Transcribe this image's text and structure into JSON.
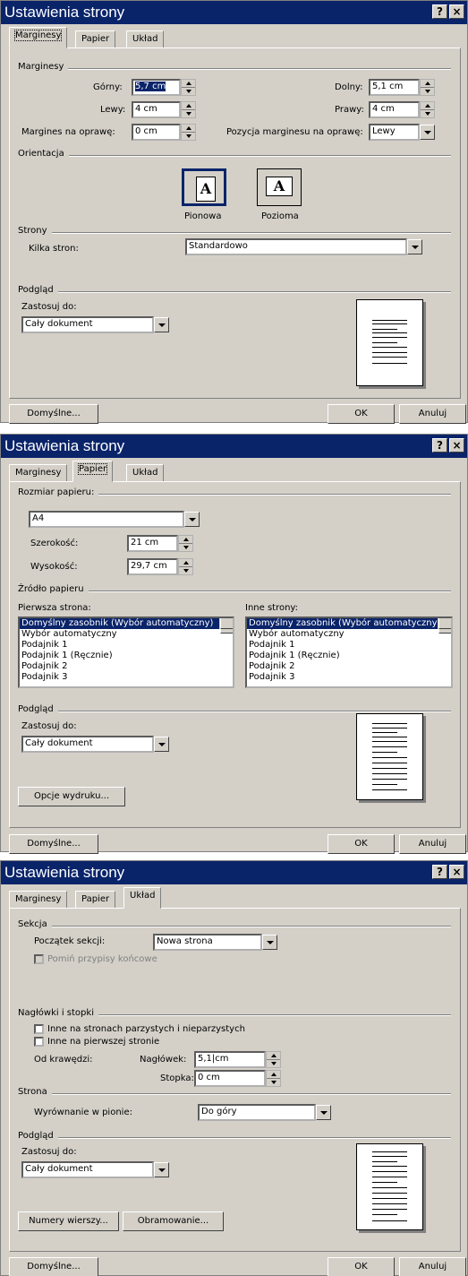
{
  "d1": {
    "title": "Ustawienia strony",
    "tabs": [
      "Marginesy",
      "Papier",
      "Układ"
    ],
    "g_margins": "Marginesy",
    "top_label": "Górny:",
    "top_value": "5,7 cm",
    "bottom_label": "Dolny:",
    "bottom_value": "5,1 cm",
    "left_label": "Lewy:",
    "left_value": "4 cm",
    "right_label": "Prawy:",
    "right_value": "4 cm",
    "gutter_label": "Margines na oprawę:",
    "gutter_value": "0 cm",
    "gutterpos_label": "Pozycja marginesu na oprawę:",
    "gutterpos_value": "Lewy",
    "g_orient": "Orientacja",
    "portrait": "Pionowa",
    "landscape": "Pozioma",
    "glyph": "A",
    "g_pages": "Strony",
    "pages_label": "Kilka stron:",
    "pages_value": "Standardowo",
    "g_preview": "Podgląd",
    "apply_label": "Zastosuj do:",
    "apply_value": "Cały dokument",
    "default_btn": "Domyślne...",
    "ok_btn": "OK",
    "cancel_btn": "Anuluj"
  },
  "d2": {
    "title": "Ustawienia strony",
    "tabs": [
      "Marginesy",
      "Papier",
      "Układ"
    ],
    "g_size": "Rozmiar papieru:",
    "size_value": "A4",
    "width_label": "Szerokość:",
    "width_value": "21 cm",
    "height_label": "Wysokość:",
    "height_value": "29,7 cm",
    "g_source": "Źródło papieru",
    "first_label": "Pierwsza strona:",
    "other_label": "Inne strony:",
    "trays": [
      "Domyślny zasobnik (Wybór automatyczny)",
      "Wybór automatyczny",
      "Podajnik 1",
      "Podajnik 1 (Ręcznie)",
      "Podajnik 2",
      "Podajnik 3"
    ],
    "g_preview": "Podgląd",
    "apply_label": "Zastosuj do:",
    "apply_value": "Cały dokument",
    "print_opts_btn": "Opcje wydruku...",
    "default_btn": "Domyślne...",
    "ok_btn": "OK",
    "cancel_btn": "Anuluj"
  },
  "d3": {
    "title": "Ustawienia strony",
    "tabs": [
      "Marginesy",
      "Papier",
      "Układ"
    ],
    "g_section": "Sekcja",
    "section_start_label": "Początek sekcji:",
    "section_start_value": "Nowa strona",
    "suppress_endnotes": "Pomiń przypisy końcowe",
    "g_hf": "Nagłówki i stopki",
    "odd_even": "Inne na stronach parzystych i nieparzystych",
    "first_page": "Inne na pierwszej stronie",
    "from_edge": "Od krawędzi:",
    "header_label": "Nagłówek:",
    "header_value": "5,1|cm",
    "footer_label": "Stopka:",
    "footer_value": "0 cm",
    "g_page": "Strona",
    "valign_label": "Wyrównanie w pionie:",
    "valign_value": "Do góry",
    "g_preview": "Podgląd",
    "apply_label": "Zastosuj do:",
    "apply_value": "Cały dokument",
    "line_numbers_btn": "Numery wierszy...",
    "borders_btn": "Obramowanie...",
    "default_btn": "Domyślne...",
    "ok_btn": "OK",
    "cancel_btn": "Anuluj"
  },
  "title_buttons": {
    "help": "?",
    "close": "×"
  },
  "colors": {
    "titlebar": "#0a246a",
    "face": "#d4d0c8",
    "selection": "#0a246a"
  }
}
